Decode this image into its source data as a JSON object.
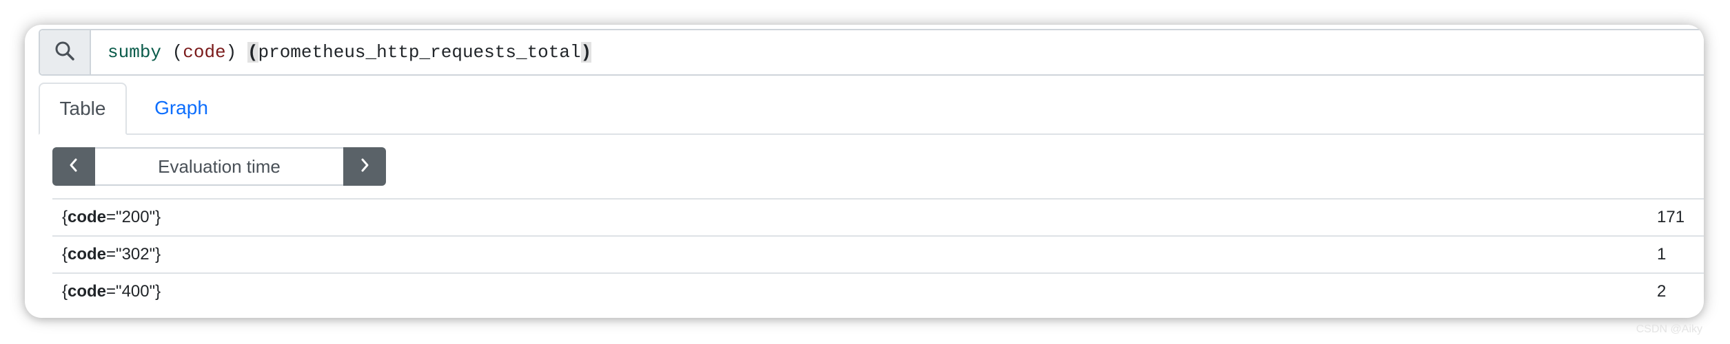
{
  "query": {
    "fn": "sum",
    "kw": "by",
    "open_paren": " (",
    "label": "code",
    "close_paren": ") ",
    "arg_open": "(",
    "metric": "prometheus_http_requests_total",
    "arg_close": ")",
    "search_icon": "search-icon"
  },
  "tabs": [
    {
      "label": "Table",
      "active": true
    },
    {
      "label": "Graph",
      "active": false
    }
  ],
  "eval": {
    "placeholder": "Evaluation time",
    "prev_icon": "chevron-left-icon",
    "next_icon": "chevron-right-icon"
  },
  "results": [
    {
      "open": "{",
      "label": "code",
      "eq": "=\"200\"}",
      "value": "171"
    },
    {
      "open": "{",
      "label": "code",
      "eq": "=\"302\"}",
      "value": "1"
    },
    {
      "open": "{",
      "label": "code",
      "eq": "=\"400\"}",
      "value": "2"
    }
  ],
  "watermark": "CSDN @Aiky"
}
